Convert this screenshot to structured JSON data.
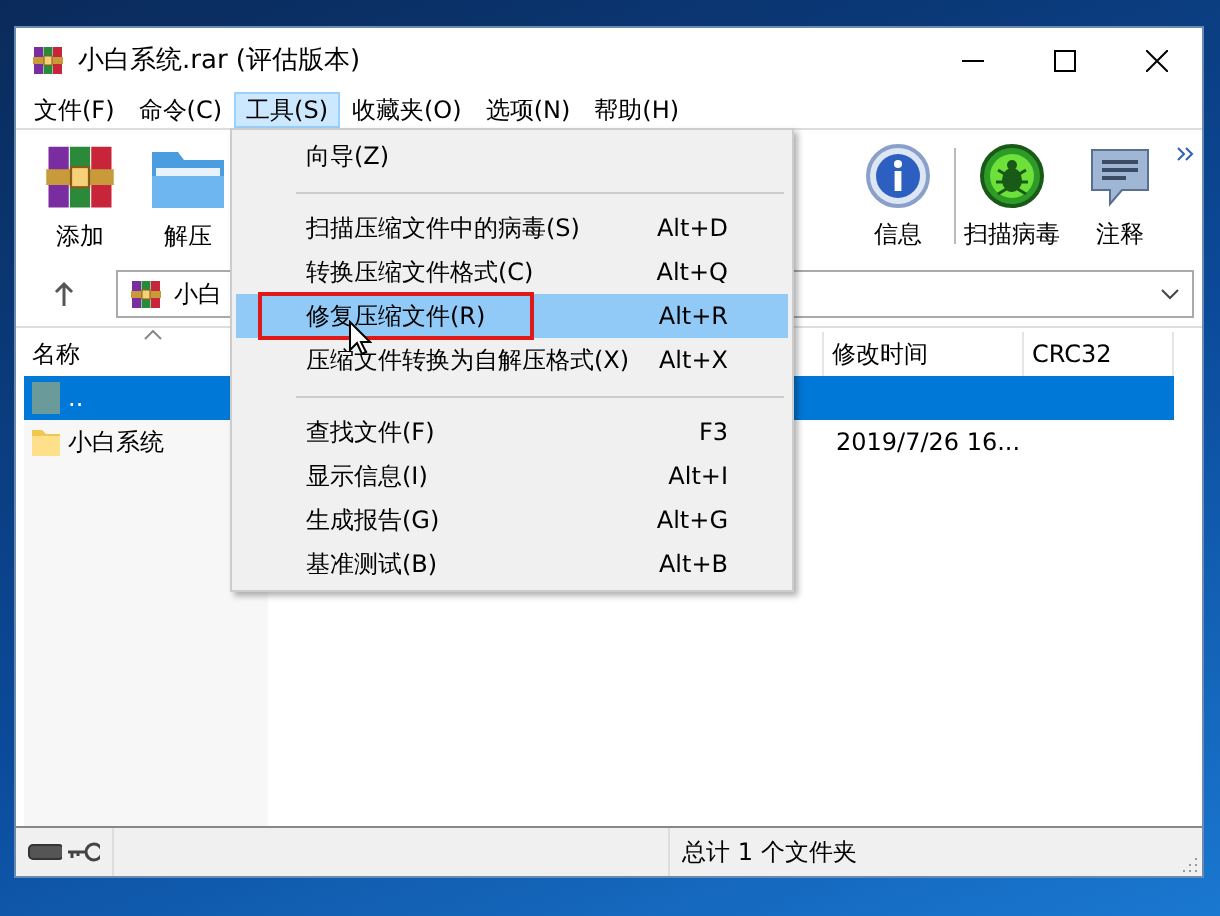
{
  "window": {
    "title": "小白系统.rar (评估版本)"
  },
  "menu_bar": [
    {
      "label": "文件(F)",
      "selected": false
    },
    {
      "label": "命令(C)",
      "selected": false
    },
    {
      "label": "工具(S)",
      "selected": true
    },
    {
      "label": "收藏夹(O)",
      "selected": false
    },
    {
      "label": "选项(N)",
      "selected": false
    },
    {
      "label": "帮助(H)",
      "selected": false
    }
  ],
  "toolbar": {
    "left": [
      {
        "label": "添加",
        "kind": "add"
      },
      {
        "label": "解压",
        "kind": "extract"
      }
    ],
    "right": [
      {
        "label": "信息",
        "kind": "info"
      },
      {
        "label": "扫描病毒",
        "kind": "scan"
      },
      {
        "label": "注释",
        "kind": "comment"
      }
    ]
  },
  "address_bar": {
    "path": "小白"
  },
  "file_list": {
    "columns": [
      {
        "label": "名称",
        "sorted": true
      },
      {
        "label": "修改时间",
        "sorted": false
      },
      {
        "label": "CRC32",
        "sorted": false
      }
    ],
    "rows": [
      {
        "name": "..",
        "kind": "parent",
        "selected": true
      },
      {
        "name": "小白系统",
        "kind": "folder",
        "modified": "2019/7/26 16...",
        "selected": false
      }
    ]
  },
  "tools_menu": {
    "items": [
      {
        "kind": "item",
        "label": "向导(Z)",
        "selected": false,
        "annotated": false
      },
      {
        "kind": "separator"
      },
      {
        "kind": "item",
        "label": "扫描压缩文件中的病毒(S)",
        "shortcut": "Alt+D",
        "selected": false,
        "annotated": false
      },
      {
        "kind": "item",
        "label": "转换压缩文件格式(C)",
        "shortcut": "Alt+Q",
        "selected": false,
        "annotated": false
      },
      {
        "kind": "item",
        "label": "修复压缩文件(R)",
        "shortcut": "Alt+R",
        "selected": true,
        "annotated": true
      },
      {
        "kind": "item",
        "label": "压缩文件转换为自解压格式(X)",
        "shortcut": "Alt+X",
        "selected": false,
        "annotated": false
      },
      {
        "kind": "separator"
      },
      {
        "kind": "item",
        "label": "查找文件(F)",
        "shortcut": "F3",
        "selected": false,
        "annotated": false
      },
      {
        "kind": "item",
        "label": "显示信息(I)",
        "shortcut": "Alt+I",
        "selected": false,
        "annotated": false
      },
      {
        "kind": "item",
        "label": "生成报告(G)",
        "shortcut": "Alt+G",
        "selected": false,
        "annotated": false
      },
      {
        "kind": "item",
        "label": "基准测试(B)",
        "shortcut": "Alt+B",
        "selected": false,
        "annotated": false
      }
    ]
  },
  "status_bar": {
    "text": "总计 1 个文件夹"
  }
}
